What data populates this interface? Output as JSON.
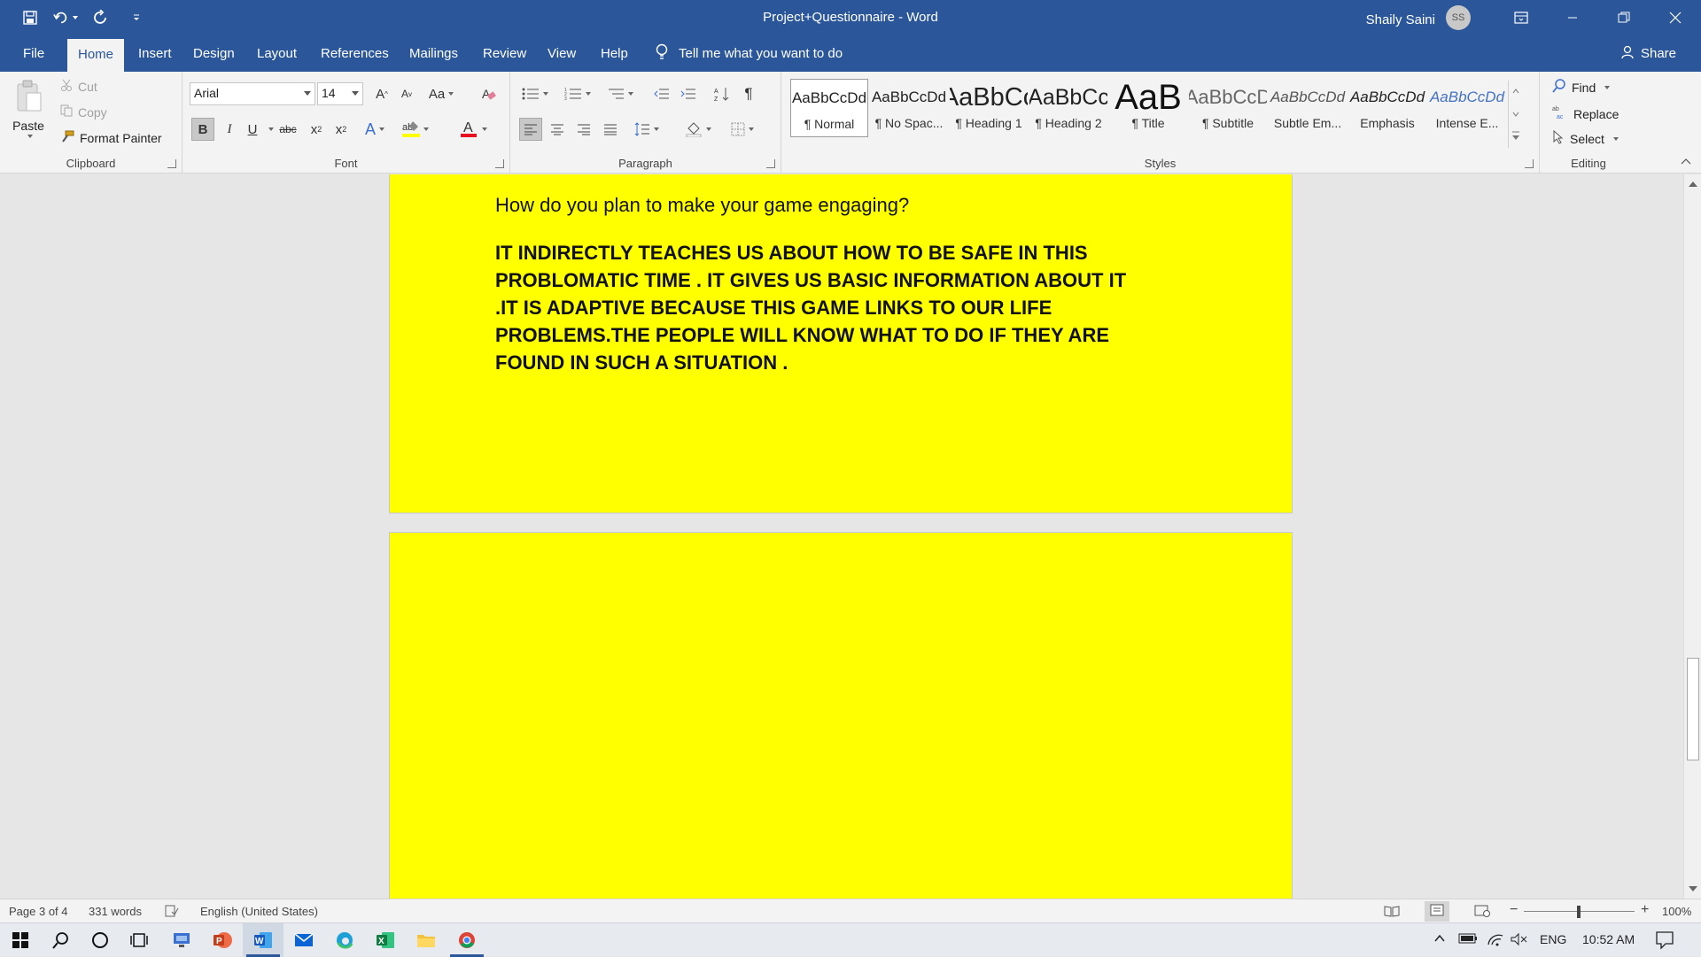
{
  "titlebar": {
    "document_title": "Project+Questionnaire",
    "app_name": "Word",
    "separator": " - ",
    "user_name": "Shaily Saini",
    "user_initials": "SS"
  },
  "tabs": [
    {
      "label": "File"
    },
    {
      "label": "Home"
    },
    {
      "label": "Insert"
    },
    {
      "label": "Design"
    },
    {
      "label": "Layout"
    },
    {
      "label": "References"
    },
    {
      "label": "Mailings"
    },
    {
      "label": "Review"
    },
    {
      "label": "View"
    },
    {
      "label": "Help"
    }
  ],
  "tellme": "Tell me what you want to do",
  "share": "Share",
  "clipboard": {
    "paste": "Paste",
    "cut": "Cut",
    "copy": "Copy",
    "format_painter": "Format Painter",
    "label": "Clipboard"
  },
  "font": {
    "name": "Arial",
    "size": "14",
    "label": "Font",
    "case_label": "Aa",
    "strike_label": "abc"
  },
  "paragraph": {
    "label": "Paragraph"
  },
  "styles": {
    "label": "Styles",
    "items": [
      {
        "preview": "AaBbCcDd",
        "name": "¶ Normal"
      },
      {
        "preview": "AaBbCcDd",
        "name": "¶ No Spac..."
      },
      {
        "preview": "AaBbCc",
        "name": "¶ Heading 1"
      },
      {
        "preview": "AaBbCc",
        "name": "¶ Heading 2"
      },
      {
        "preview": "AaB",
        "name": "¶ Title"
      },
      {
        "preview": "AaBbCcD",
        "name": "¶ Subtitle"
      },
      {
        "preview": "AaBbCcDd",
        "name": "Subtle Em..."
      },
      {
        "preview": "AaBbCcDd",
        "name": "Emphasis"
      },
      {
        "preview": "AaBbCcDd",
        "name": "Intense E..."
      }
    ]
  },
  "editing": {
    "find": "Find",
    "replace": "Replace",
    "select": "Select",
    "label": "Editing"
  },
  "document": {
    "question": "How do you plan to make your game engaging?",
    "answer_lines": [
      "IT INDIRECTLY TEACHES US ABOUT HOW TO BE SAFE IN THIS",
      "PROBLOMATIC TIME . IT GIVES US BASIC INFORMATION ABOUT IT",
      ".IT IS ADAPTIVE BECAUSE THIS GAME LINKS TO OUR LIFE",
      "PROBLEMS.THE PEOPLE WILL KNOW WHAT TO DO IF THEY ARE",
      "FOUND IN SUCH A SITUATION ."
    ],
    "page_color": "#ffff00"
  },
  "statusbar": {
    "page": "Page 3 of 4",
    "words": "331 words",
    "language": "English (United States)",
    "zoom": "100%"
  },
  "taskbar": {
    "lang": "ENG",
    "time": "10:52 AM"
  },
  "colors": {
    "word_blue": "#2b579a",
    "font_color_red": "#e81123",
    "highlight_yellow": "#ffff00"
  }
}
